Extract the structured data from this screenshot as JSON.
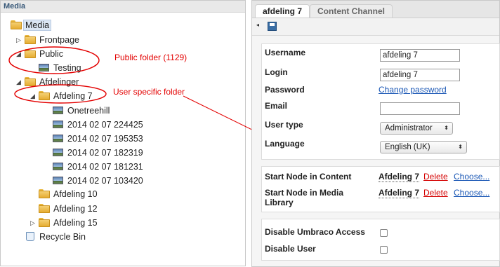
{
  "left_panel": {
    "title": "Media"
  },
  "tree": {
    "root": "Media",
    "frontpage": "Frontpage",
    "public": "Public",
    "testing": "Testing",
    "afdelinger": "Afdelinger",
    "afdeling7": "Afdeling 7",
    "onetreehill": "Onetreehill",
    "img1": "2014 02 07 224425",
    "img2": "2014 02 07 195353",
    "img3": "2014 02 07 182319",
    "img4": "2014 02 07 181231",
    "img5": "2014 02 07 103420",
    "afdeling10": "Afdeling 10",
    "afdeling12": "Afdeling 12",
    "afdeling15": "Afdeling 15",
    "recycle": "Recycle Bin"
  },
  "annotations": {
    "public_folder": "Public folder (1129)",
    "user_folder": "User specific folder"
  },
  "tabs": {
    "active": "afdeling 7",
    "inactive": "Content Channel"
  },
  "form": {
    "username_label": "Username",
    "username_value": "afdeling 7",
    "login_label": "Login",
    "login_value": "afdeling 7",
    "password_label": "Password",
    "change_password": "Change password",
    "email_label": "Email",
    "email_value": "",
    "usertype_label": "User type",
    "usertype_value": "Administrator",
    "language_label": "Language",
    "language_value": "English (UK)"
  },
  "start_nodes": {
    "content_label": "Start Node in Content",
    "content_node": "Afdeling 7",
    "media_label_1": "Start Node in Media",
    "media_label_2": "Library",
    "media_node": "Afdeling 7",
    "delete": "Delete",
    "choose": "Choose..."
  },
  "access": {
    "disable_access": "Disable Umbraco Access",
    "disable_user": "Disable User"
  },
  "colors": {
    "annotation": "#e30000",
    "link": "#1a57b5",
    "delete": "#d40000"
  }
}
